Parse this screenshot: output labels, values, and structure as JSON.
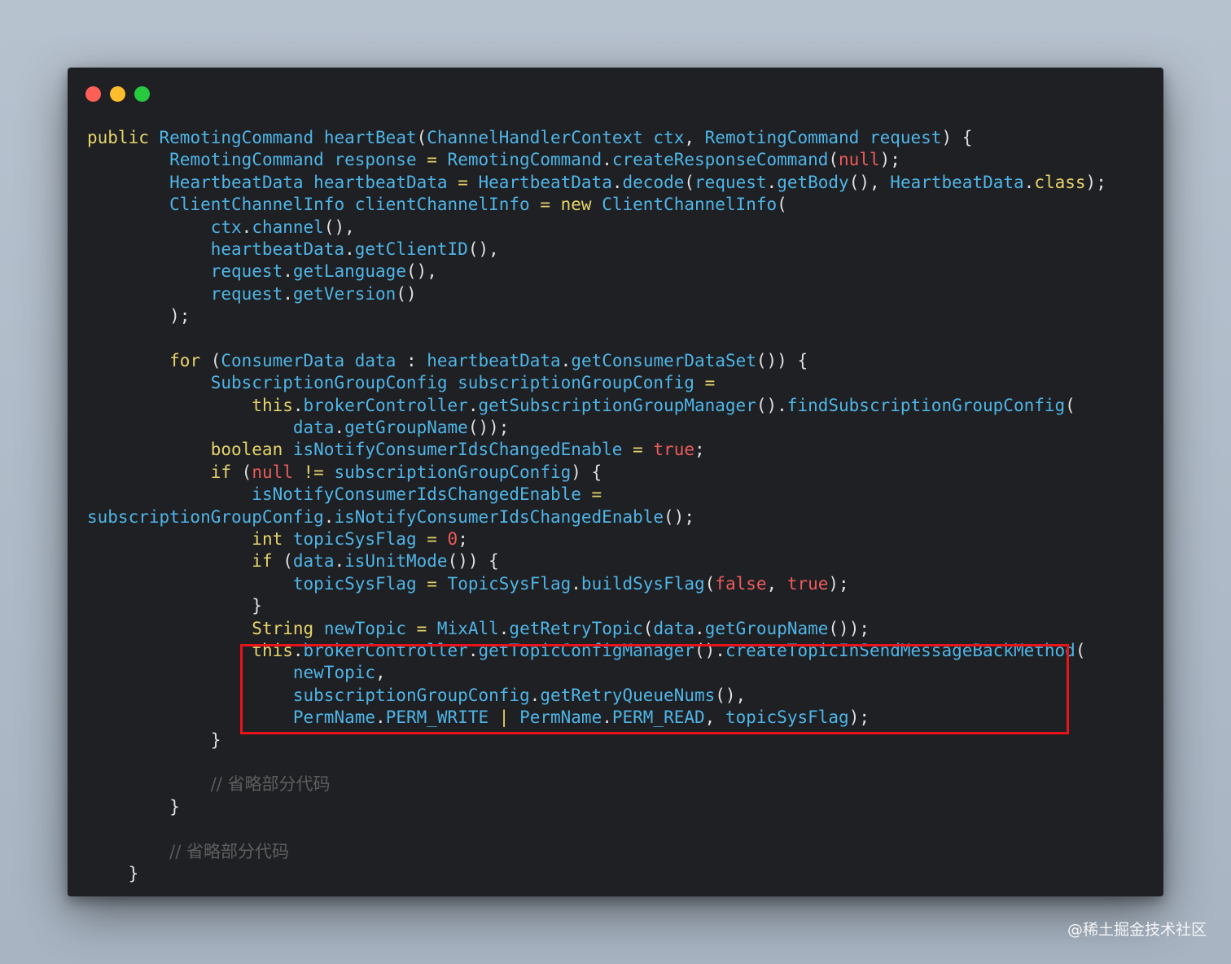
{
  "window": {
    "controls": [
      "close",
      "minimize",
      "maximize"
    ],
    "colors": {
      "close": "#ff5f56",
      "minimize": "#ffbd2e",
      "maximize": "#27c93f",
      "background": "#1f2024"
    }
  },
  "code": {
    "lines": [
      [
        [
          "kw",
          "public "
        ],
        [
          "ty",
          "RemotingCommand "
        ],
        [
          "fn",
          "heartBeat"
        ],
        [
          "pl",
          "("
        ],
        [
          "ty",
          "ChannelHandlerContext "
        ],
        [
          "id",
          "ctx"
        ],
        [
          "pl",
          ", "
        ],
        [
          "ty",
          "RemotingCommand "
        ],
        [
          "id",
          "request"
        ],
        [
          "pl",
          ") {"
        ]
      ],
      [
        [
          "pl",
          "        "
        ],
        [
          "ty",
          "RemotingCommand "
        ],
        [
          "id",
          "response "
        ],
        [
          "op",
          "= "
        ],
        [
          "ty",
          "RemotingCommand"
        ],
        [
          "pl",
          "."
        ],
        [
          "fn",
          "createResponseCommand"
        ],
        [
          "pl",
          "("
        ],
        [
          "lit",
          "null"
        ],
        [
          "pl",
          ");"
        ]
      ],
      [
        [
          "pl",
          "        "
        ],
        [
          "ty",
          "HeartbeatData "
        ],
        [
          "id",
          "heartbeatData "
        ],
        [
          "op",
          "= "
        ],
        [
          "ty",
          "HeartbeatData"
        ],
        [
          "pl",
          "."
        ],
        [
          "fn",
          "decode"
        ],
        [
          "pl",
          "("
        ],
        [
          "id",
          "request"
        ],
        [
          "pl",
          "."
        ],
        [
          "fn",
          "getBody"
        ],
        [
          "pl",
          "(), "
        ],
        [
          "ty",
          "HeartbeatData"
        ],
        [
          "pl",
          "."
        ],
        [
          "kw",
          "class"
        ],
        [
          "pl",
          ");"
        ]
      ],
      [
        [
          "pl",
          "        "
        ],
        [
          "ty",
          "ClientChannelInfo "
        ],
        [
          "id",
          "clientChannelInfo "
        ],
        [
          "op",
          "= "
        ],
        [
          "kw",
          "new "
        ],
        [
          "ty",
          "ClientChannelInfo"
        ],
        [
          "pl",
          "("
        ]
      ],
      [
        [
          "pl",
          "            "
        ],
        [
          "id",
          "ctx"
        ],
        [
          "pl",
          "."
        ],
        [
          "fn",
          "channel"
        ],
        [
          "pl",
          "(),"
        ]
      ],
      [
        [
          "pl",
          "            "
        ],
        [
          "id",
          "heartbeatData"
        ],
        [
          "pl",
          "."
        ],
        [
          "fn",
          "getClientID"
        ],
        [
          "pl",
          "(),"
        ]
      ],
      [
        [
          "pl",
          "            "
        ],
        [
          "id",
          "request"
        ],
        [
          "pl",
          "."
        ],
        [
          "fn",
          "getLanguage"
        ],
        [
          "pl",
          "(),"
        ]
      ],
      [
        [
          "pl",
          "            "
        ],
        [
          "id",
          "request"
        ],
        [
          "pl",
          "."
        ],
        [
          "fn",
          "getVersion"
        ],
        [
          "pl",
          "()"
        ]
      ],
      [
        [
          "pl",
          "        );"
        ]
      ],
      [],
      [
        [
          "pl",
          "        "
        ],
        [
          "kw",
          "for "
        ],
        [
          "pl",
          "("
        ],
        [
          "ty",
          "ConsumerData "
        ],
        [
          "id",
          "data "
        ],
        [
          "pl",
          ": "
        ],
        [
          "id",
          "heartbeatData"
        ],
        [
          "pl",
          "."
        ],
        [
          "fn",
          "getConsumerDataSet"
        ],
        [
          "pl",
          "()) {"
        ]
      ],
      [
        [
          "pl",
          "            "
        ],
        [
          "ty",
          "SubscriptionGroupConfig "
        ],
        [
          "id",
          "subscriptionGroupConfig "
        ],
        [
          "op",
          "="
        ]
      ],
      [
        [
          "pl",
          "                "
        ],
        [
          "kw",
          "this"
        ],
        [
          "pl",
          "."
        ],
        [
          "id",
          "brokerController"
        ],
        [
          "pl",
          "."
        ],
        [
          "fn",
          "getSubscriptionGroupManager"
        ],
        [
          "pl",
          "()."
        ],
        [
          "fn",
          "findSubscriptionGroupConfig"
        ],
        [
          "pl",
          "("
        ]
      ],
      [
        [
          "pl",
          "                    "
        ],
        [
          "id",
          "data"
        ],
        [
          "pl",
          "."
        ],
        [
          "fn",
          "getGroupName"
        ],
        [
          "pl",
          "());"
        ]
      ],
      [
        [
          "pl",
          "            "
        ],
        [
          "kw",
          "boolean "
        ],
        [
          "id",
          "isNotifyConsumerIdsChangedEnable "
        ],
        [
          "op",
          "= "
        ],
        [
          "lit",
          "true"
        ],
        [
          "pl",
          ";"
        ]
      ],
      [
        [
          "pl",
          "            "
        ],
        [
          "kw",
          "if "
        ],
        [
          "pl",
          "("
        ],
        [
          "lit",
          "null "
        ],
        [
          "op",
          "!= "
        ],
        [
          "id",
          "subscriptionGroupConfig"
        ],
        [
          "pl",
          ") {"
        ]
      ],
      [
        [
          "pl",
          "                "
        ],
        [
          "id",
          "isNotifyConsumerIdsChangedEnable "
        ],
        [
          "op",
          "="
        ]
      ],
      [
        [
          "id",
          "subscriptionGroupConfig"
        ],
        [
          "pl",
          "."
        ],
        [
          "fn",
          "isNotifyConsumerIdsChangedEnable"
        ],
        [
          "pl",
          "();"
        ]
      ],
      [
        [
          "pl",
          "                "
        ],
        [
          "kw",
          "int "
        ],
        [
          "id",
          "topicSysFlag "
        ],
        [
          "op",
          "= "
        ],
        [
          "lit",
          "0"
        ],
        [
          "pl",
          ";"
        ]
      ],
      [
        [
          "pl",
          "                "
        ],
        [
          "kw",
          "if "
        ],
        [
          "pl",
          "("
        ],
        [
          "id",
          "data"
        ],
        [
          "pl",
          "."
        ],
        [
          "fn",
          "isUnitMode"
        ],
        [
          "pl",
          "()) {"
        ]
      ],
      [
        [
          "pl",
          "                    "
        ],
        [
          "id",
          "topicSysFlag "
        ],
        [
          "op",
          "= "
        ],
        [
          "ty",
          "TopicSysFlag"
        ],
        [
          "pl",
          "."
        ],
        [
          "fn",
          "buildSysFlag"
        ],
        [
          "pl",
          "("
        ],
        [
          "lit",
          "false"
        ],
        [
          "pl",
          ", "
        ],
        [
          "lit",
          "true"
        ],
        [
          "pl",
          ");"
        ]
      ],
      [
        [
          "pl",
          "                }"
        ]
      ],
      [
        [
          "pl",
          "                "
        ],
        [
          "kw",
          "String "
        ],
        [
          "id",
          "newTopic "
        ],
        [
          "op",
          "= "
        ],
        [
          "ty",
          "MixAll"
        ],
        [
          "pl",
          "."
        ],
        [
          "fn",
          "getRetryTopic"
        ],
        [
          "pl",
          "("
        ],
        [
          "id",
          "data"
        ],
        [
          "pl",
          "."
        ],
        [
          "fn",
          "getGroupName"
        ],
        [
          "pl",
          "());"
        ]
      ],
      [
        [
          "pl",
          "                "
        ],
        [
          "kw",
          "this"
        ],
        [
          "pl",
          "."
        ],
        [
          "id",
          "brokerController"
        ],
        [
          "pl",
          "."
        ],
        [
          "fn",
          "getTopicConfigManager"
        ],
        [
          "pl",
          "()."
        ],
        [
          "fn",
          "createTopicInSendMessageBackMethod"
        ],
        [
          "pl",
          "("
        ]
      ],
      [
        [
          "pl",
          "                    "
        ],
        [
          "id",
          "newTopic"
        ],
        [
          "pl",
          ","
        ]
      ],
      [
        [
          "pl",
          "                    "
        ],
        [
          "id",
          "subscriptionGroupConfig"
        ],
        [
          "pl",
          "."
        ],
        [
          "fn",
          "getRetryQueueNums"
        ],
        [
          "pl",
          "(),"
        ]
      ],
      [
        [
          "pl",
          "                    "
        ],
        [
          "ty",
          "PermName"
        ],
        [
          "pl",
          "."
        ],
        [
          "id",
          "PERM_WRITE "
        ],
        [
          "op",
          "| "
        ],
        [
          "ty",
          "PermName"
        ],
        [
          "pl",
          "."
        ],
        [
          "id",
          "PERM_READ"
        ],
        [
          "pl",
          ", "
        ],
        [
          "id",
          "topicSysFlag"
        ],
        [
          "pl",
          ");"
        ]
      ],
      [
        [
          "pl",
          "            }"
        ]
      ],
      [],
      [
        [
          "pl",
          "            "
        ],
        [
          "cm",
          "// 省略部分代码"
        ]
      ],
      [
        [
          "pl",
          "        }"
        ]
      ],
      [],
      [
        [
          "pl",
          "        "
        ],
        [
          "cm",
          "// 省略部分代码"
        ]
      ],
      [
        [
          "pl",
          "    }"
        ]
      ]
    ]
  },
  "highlight": {
    "color": "#e8141b",
    "from_line": 23,
    "to_line": 26
  },
  "watermark": "@稀土掘金技术社区"
}
